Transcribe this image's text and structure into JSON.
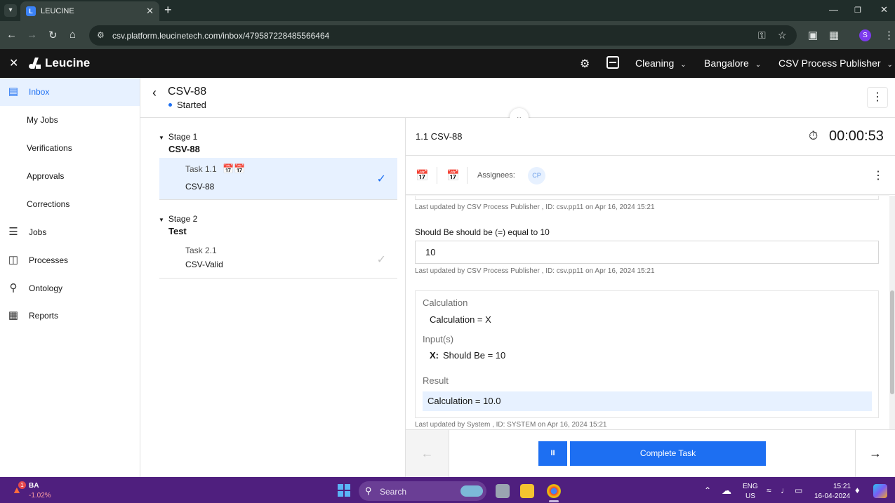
{
  "browser": {
    "tab_title": "LEUCINE",
    "tab_favicon": "L",
    "url": "csv.platform.leucinetech.com/inbox/479587228485566464",
    "profile_initial": "S",
    "icons": [
      "tab-menu-icon",
      "new-tab-icon",
      "back-icon",
      "forward-icon",
      "reload-icon",
      "home-icon",
      "site-info-icon",
      "key-icon",
      "star-icon",
      "camera-icon",
      "extensions-icon",
      "more-icon",
      "minimize-icon",
      "maximize-icon",
      "close-icon"
    ]
  },
  "appbar": {
    "brand": "Leucine",
    "facility_dropdown": "Cleaning",
    "location_dropdown": "Bangalore",
    "role_dropdown": "CSV Process Publisher",
    "icons": [
      "close-icon",
      "gear-icon",
      "scan-icon",
      "chevron-down-icon"
    ]
  },
  "sidebar": {
    "items": [
      {
        "label": "Inbox",
        "icon": "inbox-icon",
        "active": true
      },
      {
        "label": "My Jobs"
      },
      {
        "label": "Verifications"
      },
      {
        "label": "Approvals"
      },
      {
        "label": "Corrections"
      },
      {
        "label": "Jobs",
        "icon": "clipboard-icon"
      },
      {
        "label": "Processes",
        "icon": "flow-icon"
      },
      {
        "label": "Ontology",
        "icon": "hierarchy-icon"
      },
      {
        "label": "Reports",
        "icon": "calculator-icon"
      }
    ]
  },
  "job": {
    "title": "CSV-88",
    "status": "Started"
  },
  "stages": [
    {
      "label": "Stage 1",
      "name": "CSV-88",
      "task": {
        "label": "Task 1.1",
        "name": "CSV-88"
      }
    },
    {
      "label": "Stage 2",
      "name": "Test",
      "task": {
        "label": "Task 2.1",
        "name": "CSV-Valid"
      }
    }
  ],
  "task_panel": {
    "title": "1.1 CSV-88",
    "timer": "00:00:53",
    "assignees_label": "Assignees:",
    "assignee_initials": "CP",
    "meta_1": "Last updated by CSV Process Publisher , ID: csv.pp11 on Apr 16, 2024 15:21",
    "field_label": "Should Be should be (=) equal to 10",
    "field_value": "10",
    "meta_2": "Last updated by CSV Process Publisher , ID: csv.pp11 on Apr 16, 2024 15:21",
    "calc": {
      "heading": "Calculation",
      "expression": "Calculation = X",
      "inputs_heading": "Input(s)",
      "input_var": "X:",
      "input_value": "Should Be = 10",
      "result_heading": "Result",
      "result_value": "Calculation = 10.0"
    },
    "meta_3": "Last updated by System , ID: SYSTEM on Apr 16, 2024 15:21"
  },
  "footer": {
    "complete_label": "Complete Task",
    "pause_glyph": "II"
  },
  "taskbar": {
    "stock_name": "BA",
    "stock_change": "-1.02%",
    "stock_badge": "1",
    "search_placeholder": "Search",
    "lang_1": "ENG",
    "lang_2": "US",
    "time": "15:21",
    "date": "16-04-2024"
  }
}
